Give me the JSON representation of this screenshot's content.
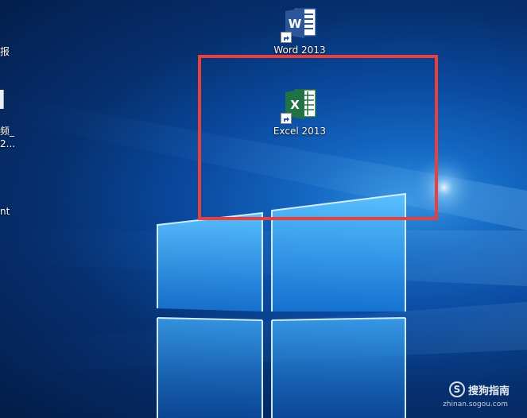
{
  "desktop": {
    "icons": [
      {
        "label": "Word 2013",
        "icon": "word-2013-icon"
      },
      {
        "label": "Excel 2013",
        "icon": "excel-2013-icon"
      }
    ],
    "left_fragments": [
      "报",
      "频_",
      "2...",
      "nt"
    ],
    "highlight_color": "#e8403f"
  },
  "watermark": {
    "brand": "搜狗指南",
    "logo_letter": "S",
    "url": "zhinan.sogou.com"
  },
  "colors": {
    "word_blue": "#2b579a",
    "excel_green": "#217346",
    "wallpaper_deep": "#041c48",
    "wallpaper_light": "#2f8fe0"
  }
}
